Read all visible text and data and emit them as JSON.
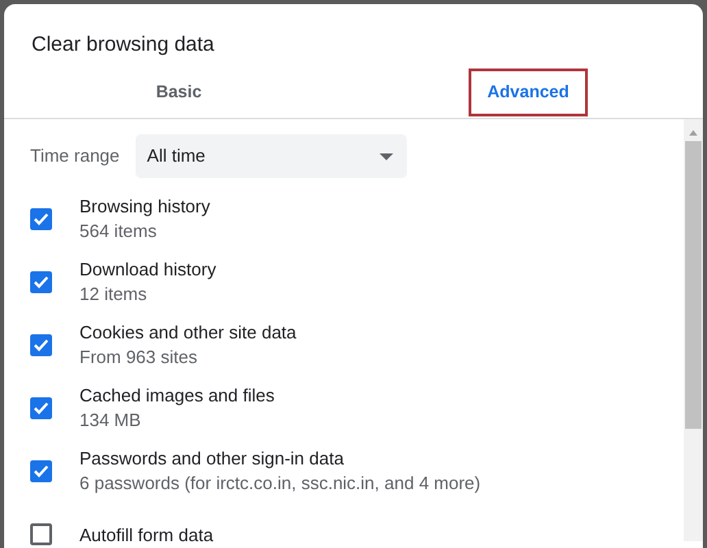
{
  "dialog": {
    "title": "Clear browsing data"
  },
  "tabs": [
    {
      "label": "Basic",
      "selected": false,
      "highlighted": false
    },
    {
      "label": "Advanced",
      "selected": true,
      "highlighted": true
    }
  ],
  "time_range": {
    "label": "Time range",
    "value": "All time"
  },
  "items": [
    {
      "title": "Browsing history",
      "detail": "564 items",
      "checked": true
    },
    {
      "title": "Download history",
      "detail": "12 items",
      "checked": true
    },
    {
      "title": "Cookies and other site data",
      "detail": "From 963 sites",
      "checked": true
    },
    {
      "title": "Cached images and files",
      "detail": "134 MB",
      "checked": true
    },
    {
      "title": "Passwords and other sign-in data",
      "detail": "6 passwords (for irctc.co.in, ssc.nic.in, and 4 more)",
      "checked": true
    },
    {
      "title": "Autofill form data",
      "checked": false
    }
  ]
}
